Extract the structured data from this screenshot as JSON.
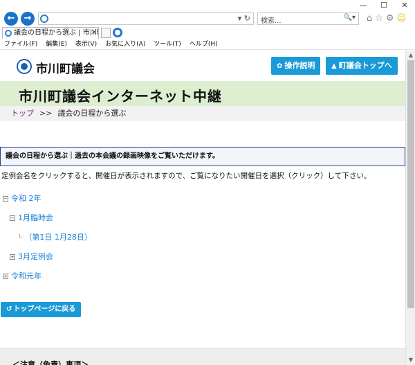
{
  "browser": {
    "window_controls": {
      "minimize": "—",
      "maximize": "☐",
      "close": "✕"
    },
    "address": {
      "value": "",
      "reload": "▾ ↻"
    },
    "search": {
      "placeholder": "検索...",
      "controls": "🔍▾"
    },
    "tab": {
      "title": "議会の日程から選ぶ | 市川町...",
      "close": "✕"
    },
    "menu": [
      "ファイル(F)",
      "編集(E)",
      "表示(V)",
      "お気に入り(A)",
      "ツール(T)",
      "ヘルプ(H)"
    ]
  },
  "header": {
    "site_name": "市川町議会",
    "buttons": [
      {
        "label": "操作説明",
        "icon": "gear-icon"
      },
      {
        "label": "町議会トップへ",
        "icon": "home-icon"
      }
    ]
  },
  "banner": {
    "title": "市川町議会インターネット中継"
  },
  "breadcrumb": {
    "home": "トップ",
    "separator": ">>",
    "current": "議会の日程から選ぶ"
  },
  "section": {
    "heading": "議会の日程から選ぶ｜過去の本会議の録画映像をご覧いただけます。"
  },
  "instructions": "定例会名をクリックすると、開催日が表示されますので、ご覧になりたい開催日を選択（クリック）して下さい。",
  "tree": {
    "year1": {
      "label": "令和 2年",
      "toggle": "−"
    },
    "session1": {
      "label": "1月臨時会",
      "toggle": "−"
    },
    "day1": {
      "label": "（第1日 1月28日）"
    },
    "session2": {
      "label": "3月定例会",
      "toggle": "+"
    },
    "year2": {
      "label": "令和元年",
      "toggle": "+"
    }
  },
  "back_button": {
    "label": "トップページに戻る"
  },
  "notice": {
    "title": "＜注意（免責）事項＞"
  }
}
